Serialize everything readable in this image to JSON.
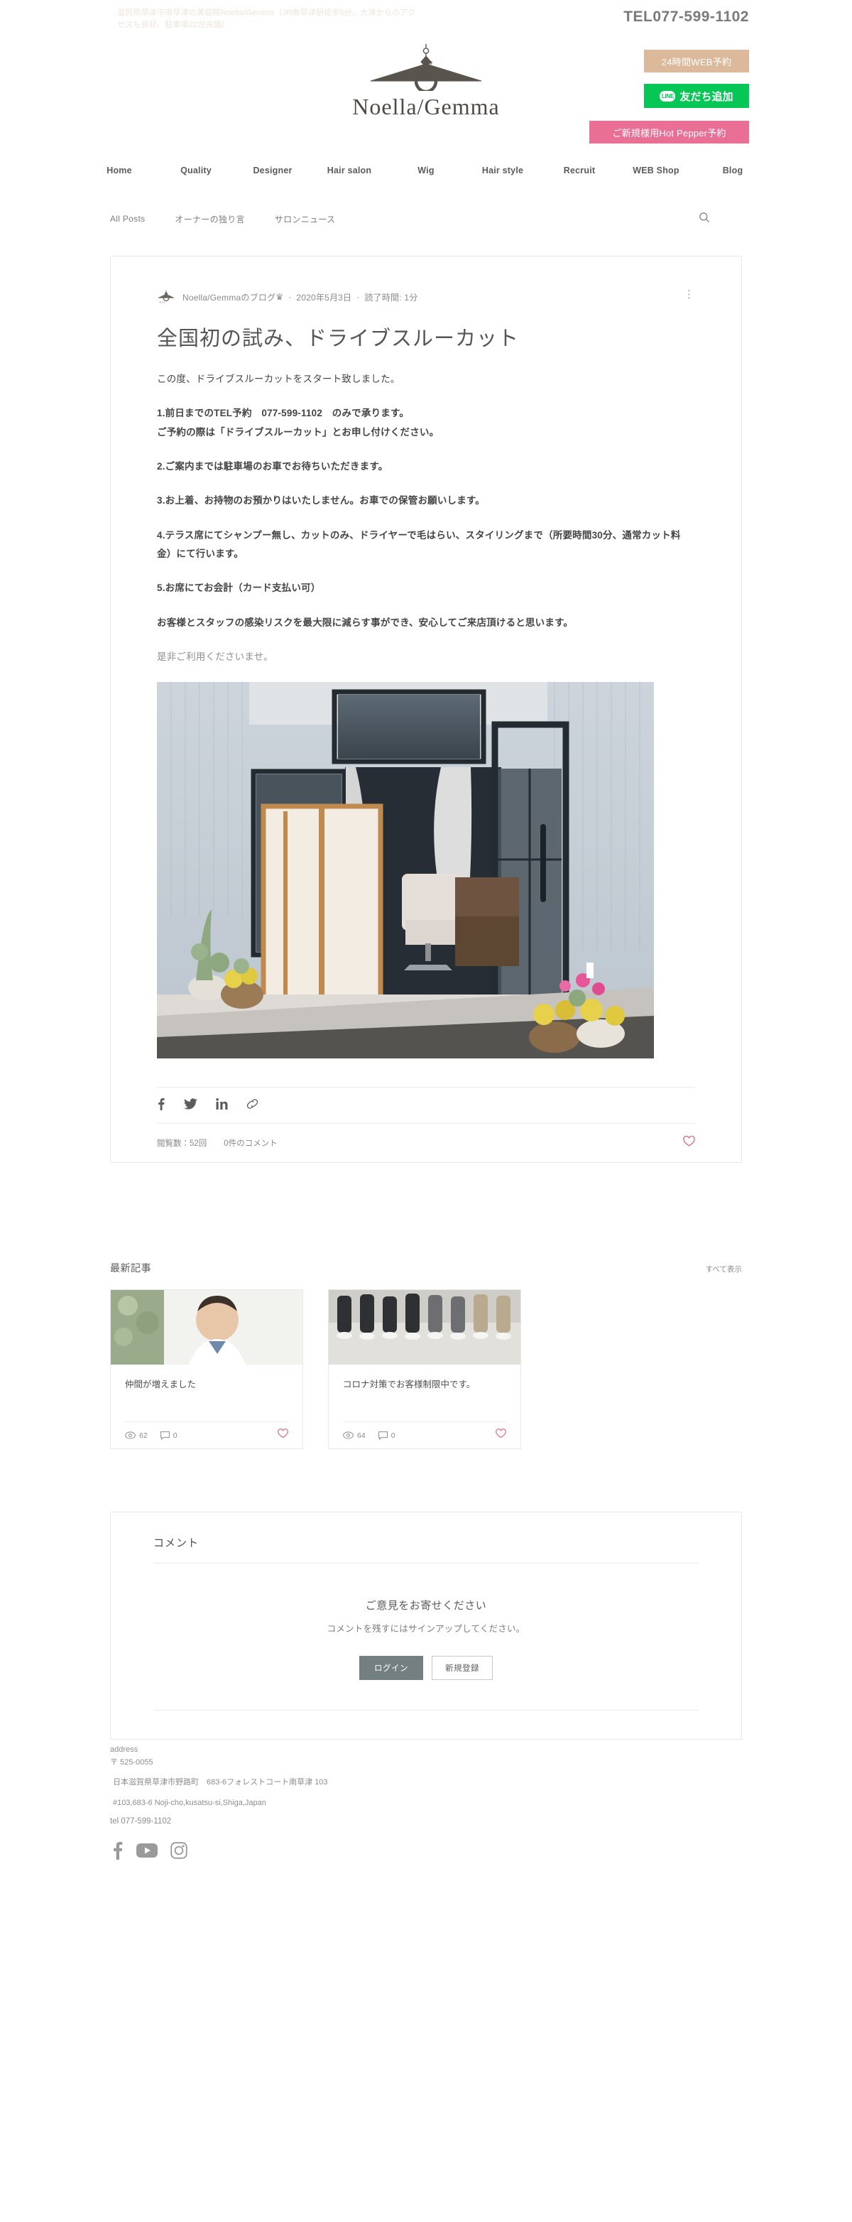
{
  "topbar": {
    "tagline": "滋賀県草津市南草津の美容院Noella/Gemma（JR南草津駅徒歩5分、大津からのアクセスも良好、駐車場22台完備）",
    "tel": "TEL077-599-1102",
    "btn_web": "24時間WEB予約",
    "btn_line_badge": "LINE",
    "btn_line": "友だち追加",
    "btn_hotpepper": "ご新規様用Hot Pepper予約",
    "logo_text": "Noella/Gemma"
  },
  "nav": {
    "items": [
      {
        "label": "Home"
      },
      {
        "label": "Quality"
      },
      {
        "label": "Designer"
      },
      {
        "label": "Hair salon"
      },
      {
        "label": "Wig"
      },
      {
        "label": "Hair style"
      },
      {
        "label": "Recruit"
      },
      {
        "label": "WEB Shop"
      },
      {
        "label": "Blog"
      }
    ]
  },
  "subnav": {
    "items": [
      {
        "label": "All Posts"
      },
      {
        "label": "オーナーの独り言"
      },
      {
        "label": "サロンニュース"
      }
    ],
    "search_icon": "search-icon"
  },
  "post": {
    "author": "Noella/Gemmaのブログ",
    "crown": "♛",
    "sep1": "·",
    "date": "2020年5月3日",
    "sep2": "·",
    "readtime": "読了時間: 1分",
    "menu_icon": "⋮",
    "title": "全国初の試み、ドライブスルーカット",
    "paragraphs": [
      {
        "text": "この度、ドライブスルーカットをスタート致しました。",
        "style": "normal"
      },
      {
        "text": "1.前日までのTEL予約　077-599-1102　のみで承ります。\nご予約の際は「ドライブスルーカット」とお申し付けください。",
        "style": "strong"
      },
      {
        "text": "2.ご案内までは駐車場のお車でお待ちいただきます。",
        "style": "strong"
      },
      {
        "text": "3.お上着、お持物のお預かりはいたしません。お車での保管お願いします。",
        "style": "strong"
      },
      {
        "text": "4.テラス席にてシャンプー無し、カットのみ、ドライヤーで毛はらい、スタイリングまで（所要時間30分、通常カット料金）にて行います。",
        "style": "strong"
      },
      {
        "text": "5.お席にてお会計（カード支払い可）",
        "style": "strong"
      },
      {
        "text": "お客様とスタッフの感染リスクを最大限に減らす事ができ、安心してご来店頂けると思います。",
        "style": "strong"
      },
      {
        "text": "是非ご利用くださいませ。",
        "style": "light"
      }
    ],
    "image_alt": "salon-entrance-photo",
    "share": [
      {
        "icon": "facebook-icon"
      },
      {
        "icon": "twitter-icon"
      },
      {
        "icon": "linkedin-icon"
      },
      {
        "icon": "link-icon"
      }
    ],
    "views": "閲覧数：52回",
    "comments_count": "0件のコメント",
    "like_icon": "heart-icon"
  },
  "recent": {
    "title": "最新記事",
    "see_all": "すべて表示",
    "cards": [
      {
        "title": "仲間が増えました",
        "views": "62",
        "comments": "0",
        "thumb": "portrait-photo"
      },
      {
        "title": "コロナ対策でお客様制限中です。",
        "views": "64",
        "comments": "0",
        "thumb": "group-photo"
      }
    ]
  },
  "comments_section": {
    "heading": "コメント",
    "cta_title": "ご意見をお寄せください",
    "cta_sub": "コメントを残すにはサインアップしてください。",
    "btn_login": "ログイン",
    "btn_signup": "新規登録"
  },
  "footer": {
    "address_label": "address",
    "postal": "〒 525-0055",
    "address_jp": "日本滋賀県草津市野路町　683-6フォレストコート南草津 103",
    "address_en": "#103,683-6 Noji-cho,kusatsu-si,Shiga,Japan",
    "tel": "tel 077-599-1102",
    "social": [
      {
        "icon": "facebook-icon"
      },
      {
        "icon": "youtube-icon"
      },
      {
        "icon": "instagram-icon"
      }
    ]
  },
  "colors": {
    "accent_web": "#ddb99b",
    "accent_line": "#06c755",
    "accent_hot": "#ea6f95",
    "heart": "#e2636d",
    "login_btn": "#74807f"
  }
}
